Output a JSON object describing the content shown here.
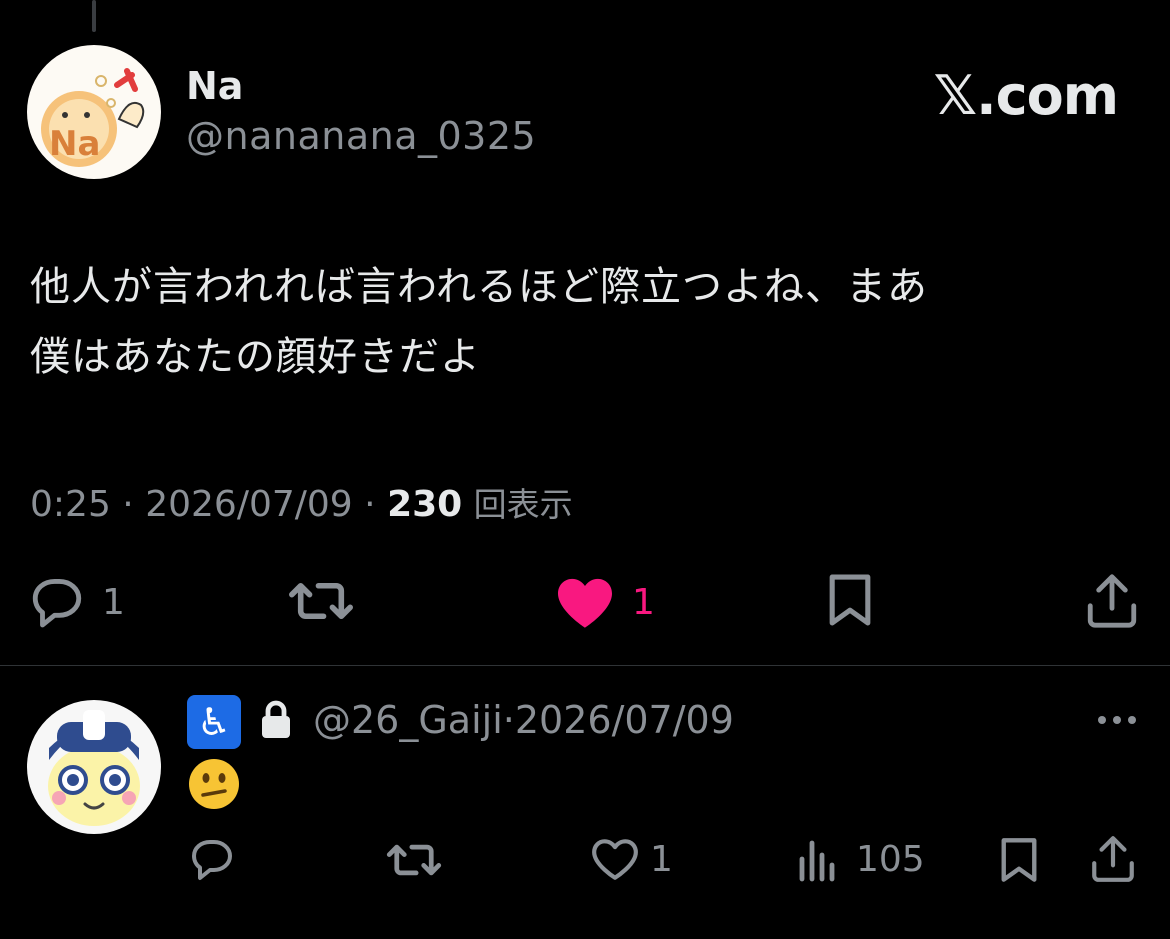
{
  "tweet": {
    "display_name": "Na",
    "handle": "@nanana​na_0325",
    "avatar_text": "Na",
    "brand": "𝕏.com",
    "text_line1": "他人が言われれば言われるほど際立つよね、まあ",
    "text_line2": "僕はあなたの顔好きだよ",
    "time": "0:25",
    "date": "2026/07/09",
    "separator": "·",
    "views": "230",
    "views_label": "回表示",
    "actions": {
      "reply_count": "1",
      "like_count": "1"
    },
    "colors": {
      "like": "#f91880",
      "muted": "#8b9096",
      "text": "#e7e9ea"
    }
  },
  "reply": {
    "badge_icon": "♿",
    "handle": "@26_Gaiji",
    "separator": "·",
    "date": "2026/07/09",
    "emoji_name": "confused-face",
    "actions": {
      "like_count": "1",
      "views": "105"
    },
    "badge_color": "#1d6be5"
  }
}
